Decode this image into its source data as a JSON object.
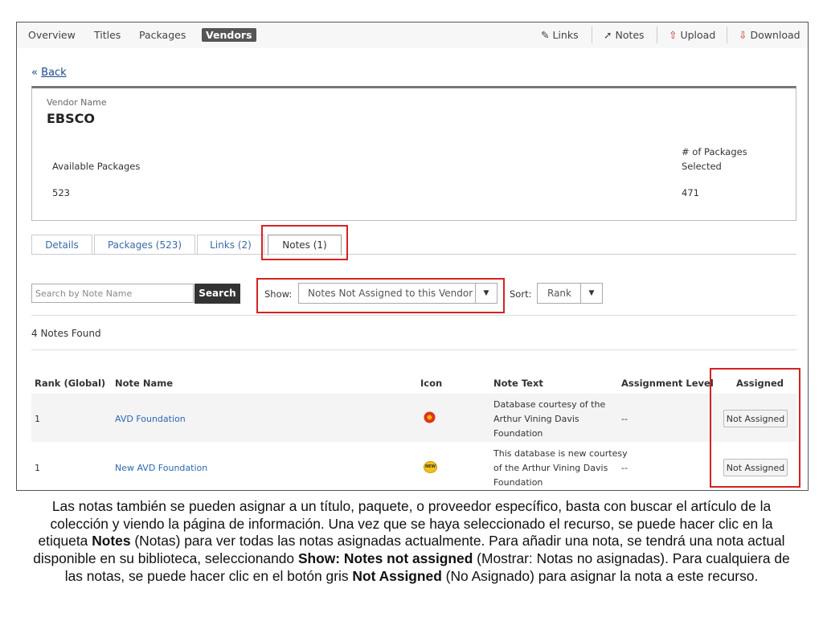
{
  "nav": {
    "items": [
      "Overview",
      "Titles",
      "Packages",
      "Vendors"
    ],
    "active": "Vendors",
    "actions": [
      {
        "label": "Links",
        "icon": "pencil-icon"
      },
      {
        "label": "Notes",
        "icon": "note-icon"
      },
      {
        "label": "Upload",
        "icon": "upload-icon"
      },
      {
        "label": "Download",
        "icon": "download-icon"
      }
    ]
  },
  "back": {
    "arrow": "«",
    "label": "Back"
  },
  "vendor": {
    "name_label": "Vendor Name",
    "name": "EBSCO",
    "available_label": "Available Packages",
    "available_value": "523",
    "selected_label_1": "# of Packages",
    "selected_label_2": "Selected",
    "selected_value": "471"
  },
  "tabs": [
    "Details",
    "Packages (523)",
    "Links (2)",
    "Notes (1)"
  ],
  "search": {
    "placeholder": "Search by Note Name",
    "button": "Search",
    "show_label": "Show:",
    "show_value": "Notes Not Assigned to this Vendor",
    "sort_label": "Sort:",
    "sort_value": "Rank"
  },
  "results_count": "4 Notes Found",
  "table": {
    "headers": [
      "Rank (Global)",
      "Note Name",
      "Icon",
      "Note Text",
      "Assignment Level",
      "Assigned"
    ],
    "rows": [
      {
        "rank": "1",
        "name": "AVD Foundation",
        "icon": "red-flower-icon",
        "text_lines": [
          "Database courtesy of the",
          "Arthur Vining Davis",
          "Foundation"
        ],
        "level": "--",
        "assigned": "Not Assigned"
      },
      {
        "rank": "1",
        "name": "New AVD Foundation",
        "icon": "new-badge-icon",
        "icon_text": "NEW",
        "text_lines": [
          "This database is new courtesy",
          "of the Arthur Vining Davis",
          "Foundation"
        ],
        "level": "--",
        "assigned": "Not Assigned"
      }
    ]
  },
  "caption": {
    "p1": "Las notas también se pueden asignar a un título, paquete, o proveedor específico, basta con buscar el artículo de la colección y viendo la página de información. Una vez que se haya seleccionado el recurso, se puede hacer clic en la etiqueta ",
    "b1": "Notes",
    "p2": " (Notas) para ver todas las notas asignadas actualmente. Para añadir una nota, se tendrá una nota actual disponible en su biblioteca, seleccionando ",
    "b2": "Show: Notes not assigned",
    "p3": "  (Mostrar: Notas no asignadas). Para cualquiera de las notas, se puede hacer clic en el botón gris ",
    "b3": "Not Assigned",
    "p4": " (No Asignado) para asignar la nota a este recurso."
  },
  "colors": {
    "highlight": "#d62222",
    "link": "#2b67b2",
    "search_button": "#333333"
  }
}
